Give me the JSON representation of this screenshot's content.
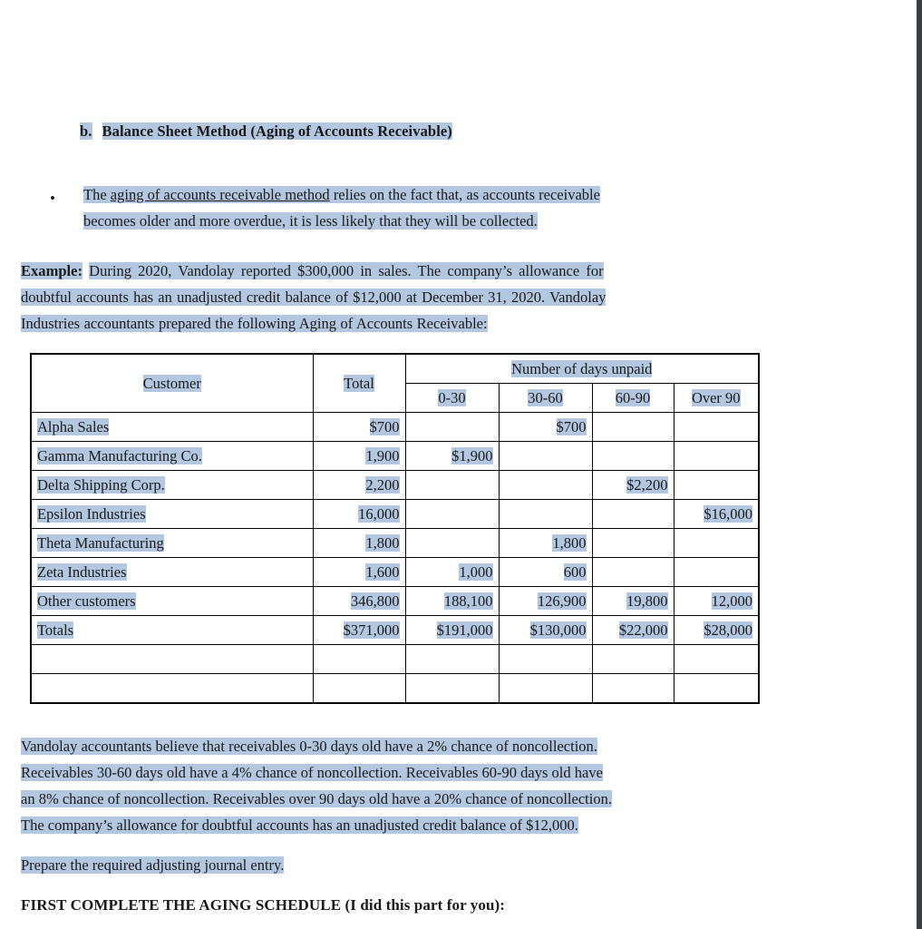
{
  "document": {
    "section_letter": "b.",
    "section_title": "Balance Sheet Method (Aging of Accounts Receivable)",
    "bullet": {
      "lead": "The ",
      "emphasis": "aging of accounts receivable method",
      "rest_line1": " relies on the fact that, as accounts receivable",
      "rest_line2": "becomes older and more overdue, it is less likely that they will be collected."
    },
    "example": {
      "label": "Example:",
      "line1": "During 2020, Vandolay reported $300,000 in sales. The company’s allowance for",
      "line2": "doubtful accounts has an unadjusted credit balance of $12,000 at December 31, 2020. Vandolay",
      "line3": "Industries accountants prepared the following Aging of Accounts Receivable:"
    },
    "notes": {
      "line1": "Vandolay accountants believe that receivables 0-30 days old have a 2% chance of noncollection.",
      "line2": "Receivables 30-60 days old have a 4% chance of noncollection. Receivables 60-90 days old have",
      "line3": "an 8% chance of noncollection. Receivables over 90 days old have a 20% chance of noncollection.",
      "line4": "The company’s allowance for doubtful accounts has an unadjusted credit balance of $12,000."
    },
    "prepare_instruction": "Prepare the required adjusting journal entry.",
    "first_complete": "FIRST COMPLETE THE AGING SCHEDULE (I did this part for you):"
  },
  "table": {
    "group_header": "Number of days unpaid",
    "headers": {
      "customer": "Customer",
      "total": "Total",
      "a": "0-30",
      "b": "30-60",
      "c": "60-90",
      "d": "Over 90"
    },
    "rows": [
      {
        "customer": "Alpha Sales",
        "total": "$700",
        "a": "",
        "b": "$700",
        "c": "",
        "d": ""
      },
      {
        "customer": "Gamma Manufacturing Co.",
        "total": "1,900",
        "a": "$1,900",
        "b": "",
        "c": "",
        "d": ""
      },
      {
        "customer": "Delta Shipping Corp.",
        "total": "2,200",
        "a": "",
        "b": "",
        "c": "$2,200",
        "d": ""
      },
      {
        "customer": "Epsilon Industries",
        "total": "16,000",
        "a": "",
        "b": "",
        "c": "",
        "d": "$16,000"
      },
      {
        "customer": "Theta Manufacturing",
        "total": "1,800",
        "a": "",
        "b": "1,800",
        "c": "",
        "d": ""
      },
      {
        "customer": "Zeta Industries",
        "total": "1,600",
        "a": "1,000",
        "b": "600",
        "c": "",
        "d": ""
      },
      {
        "customer": "Other customers",
        "total": "346,800",
        "a": "188,100",
        "b": "126,900",
        "c": "19,800",
        "d": "12,000"
      },
      {
        "customer": "Totals",
        "total": "$371,000",
        "a": "$191,000",
        "b": "$130,000",
        "c": "$22,000",
        "d": "$28,000"
      }
    ],
    "blank_rows": 2
  },
  "chart_data": {
    "type": "table",
    "title": "Aging of Accounts Receivable",
    "categories": [
      "0-30",
      "30-60",
      "60-90",
      "Over 90"
    ],
    "series": [
      {
        "name": "Alpha Sales",
        "total": 700,
        "values": [
          0,
          700,
          0,
          0
        ]
      },
      {
        "name": "Gamma Manufacturing Co.",
        "total": 1900,
        "values": [
          1900,
          0,
          0,
          0
        ]
      },
      {
        "name": "Delta Shipping Corp.",
        "total": 2200,
        "values": [
          0,
          0,
          2200,
          0
        ]
      },
      {
        "name": "Epsilon Industries",
        "total": 16000,
        "values": [
          0,
          0,
          0,
          16000
        ]
      },
      {
        "name": "Theta Manufacturing",
        "total": 1800,
        "values": [
          0,
          1800,
          0,
          0
        ]
      },
      {
        "name": "Zeta Industries",
        "total": 1600,
        "values": [
          1000,
          600,
          0,
          0
        ]
      },
      {
        "name": "Other customers",
        "total": 346800,
        "values": [
          188100,
          126900,
          19800,
          12000
        ]
      },
      {
        "name": "Totals",
        "total": 371000,
        "values": [
          191000,
          130000,
          22000,
          28000
        ]
      }
    ],
    "noncollection_rates": {
      "0-30": "2%",
      "30-60": "4%",
      "60-90": "8%",
      "Over 90": "20%"
    },
    "unadjusted_credit_balance": "$12,000",
    "sales_2020": "$300,000"
  },
  "colors": {
    "highlight": "#b3c7e0",
    "text": "#1a1a1a",
    "page_edge": "#3a3d42"
  }
}
